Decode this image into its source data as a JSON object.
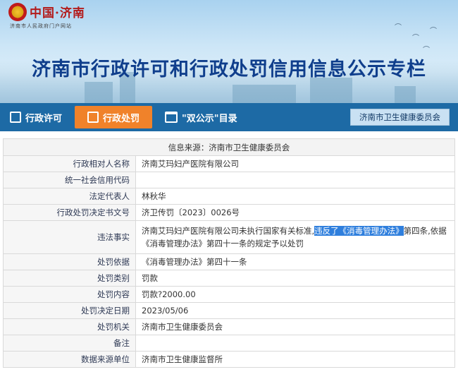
{
  "logo": {
    "title": "中国·济南",
    "subtitle": "济南市人民政府门户网站"
  },
  "banner": {
    "title": "济南市行政许可和行政处罚信用信息公示专栏"
  },
  "nav": {
    "items": [
      {
        "label": "行政许可",
        "icon": "document-icon",
        "active": false
      },
      {
        "label": "行政处罚",
        "icon": "list-icon",
        "active": true
      },
      {
        "label": "\"双公示\"目录",
        "icon": "calendar-icon",
        "active": false
      }
    ],
    "dept": "济南市卫生健康委员会"
  },
  "info": {
    "source": "信息来源：济南市卫生健康委员会",
    "rows": [
      {
        "label": "行政相对人名称",
        "value": "济南艾玛妇产医院有限公司"
      },
      {
        "label": "统一社会信用代码",
        "value": ""
      },
      {
        "label": "法定代表人",
        "value": "林秋华"
      },
      {
        "label": "行政处罚决定书文号",
        "value": "济卫传罚〔2023〕0026号"
      },
      {
        "label": "违法事实",
        "value_pre": "济南艾玛妇产医院有限公司未执行国家有关标准,",
        "value_highlight": "违反了《消毒管理办法》",
        "value_post": "第四条,依据《消毒管理办法》第四十一条的规定予以处罚"
      },
      {
        "label": "处罚依据",
        "value": "《消毒管理办法》第四十一条"
      },
      {
        "label": "处罚类别",
        "value": "罚款"
      },
      {
        "label": "处罚内容",
        "value": "罚款?2000.00"
      },
      {
        "label": "处罚决定日期",
        "value": "2023/05/06"
      },
      {
        "label": "处罚机关",
        "value": "济南市卫生健康委员会"
      },
      {
        "label": "备注",
        "value": ""
      },
      {
        "label": "数据来源单位",
        "value": "济南市卫生健康监督所"
      }
    ]
  },
  "colors": {
    "nav_bg": "#1d6aa5",
    "nav_active": "#f0822a",
    "title": "#0f3e8c",
    "highlight": "#2f7fdd"
  }
}
